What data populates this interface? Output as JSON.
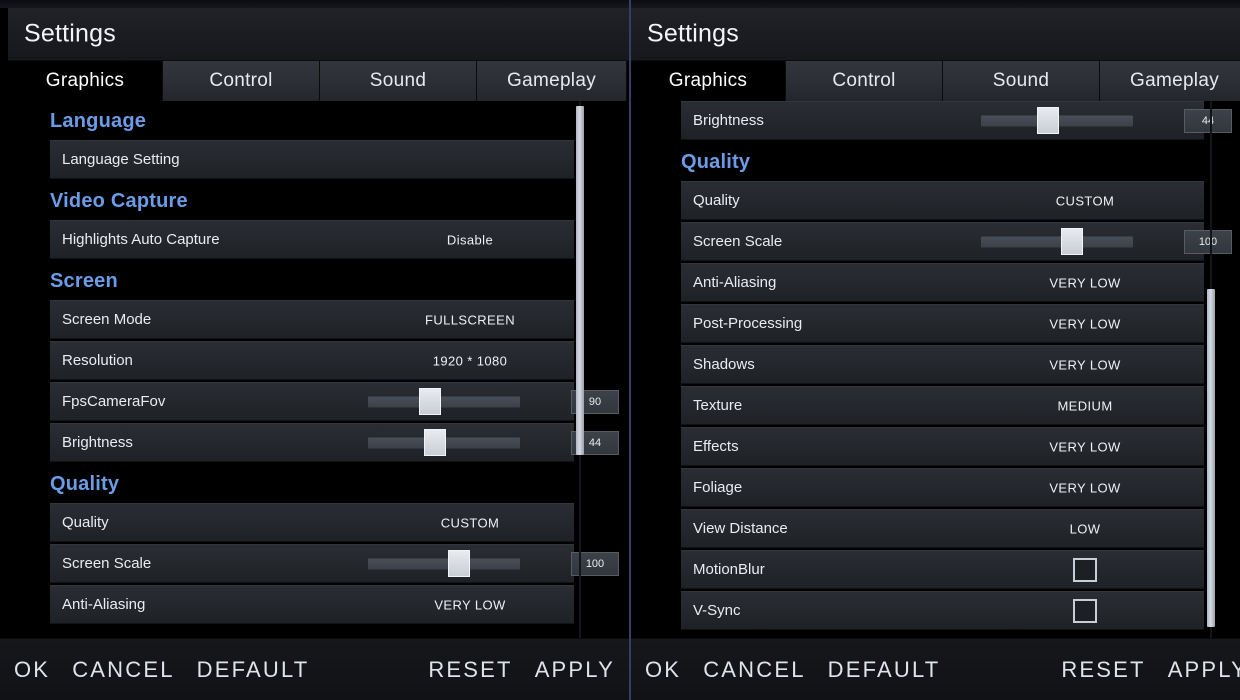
{
  "window_title": "Settings",
  "accent_section_color": "#6c9ce8",
  "divider_color": "#3a3f6e",
  "tabs": [
    {
      "label": "Graphics",
      "active": true
    },
    {
      "label": "Control",
      "active": false
    },
    {
      "label": "Sound",
      "active": false
    },
    {
      "label": "Gameplay",
      "active": false
    }
  ],
  "left_panel": {
    "title": "Settings",
    "scroll": {
      "thumb_top_pct": 1,
      "thumb_height_pct": 65
    },
    "items": [
      {
        "kind": "section",
        "label": "Language"
      },
      {
        "kind": "row",
        "label": "Language Setting",
        "value": ""
      },
      {
        "kind": "section",
        "label": "Video Capture"
      },
      {
        "kind": "row",
        "label": "Highlights Auto Capture",
        "value": "Disable"
      },
      {
        "kind": "section",
        "label": "Screen"
      },
      {
        "kind": "row",
        "label": "Screen Mode",
        "value": "FULLSCREEN"
      },
      {
        "kind": "row",
        "label": "Resolution",
        "value": "1920 * 1080"
      },
      {
        "kind": "slider",
        "label": "FpsCameraFov",
        "value": "90",
        "fill_pct": 41
      },
      {
        "kind": "slider",
        "label": "Brightness",
        "value": "44",
        "fill_pct": 44
      },
      {
        "kind": "section",
        "label": "Quality"
      },
      {
        "kind": "row",
        "label": "Quality",
        "value": "CUSTOM"
      },
      {
        "kind": "slider",
        "label": "Screen Scale",
        "value": "100",
        "fill_pct": 60
      },
      {
        "kind": "row",
        "label": "Anti-Aliasing",
        "value": "VERY LOW"
      }
    ]
  },
  "right_panel": {
    "title": "Settings",
    "scroll": {
      "thumb_top_pct": 35,
      "thumb_height_pct": 63
    },
    "items": [
      {
        "kind": "slider",
        "label": "Brightness",
        "value": "44",
        "fill_pct": 44
      },
      {
        "kind": "section",
        "label": "Quality"
      },
      {
        "kind": "row",
        "label": "Quality",
        "value": "CUSTOM"
      },
      {
        "kind": "slider",
        "label": "Screen Scale",
        "value": "100",
        "fill_pct": 60
      },
      {
        "kind": "row",
        "label": "Anti-Aliasing",
        "value": "VERY LOW"
      },
      {
        "kind": "row",
        "label": "Post-Processing",
        "value": "VERY LOW"
      },
      {
        "kind": "row",
        "label": "Shadows",
        "value": "VERY LOW"
      },
      {
        "kind": "row",
        "label": "Texture",
        "value": "MEDIUM"
      },
      {
        "kind": "row",
        "label": "Effects",
        "value": "VERY LOW"
      },
      {
        "kind": "row",
        "label": "Foliage",
        "value": "VERY LOW"
      },
      {
        "kind": "row",
        "label": "View Distance",
        "value": "LOW"
      },
      {
        "kind": "checkbox",
        "label": "MotionBlur",
        "checked": false
      },
      {
        "kind": "checkbox",
        "label": "V-Sync",
        "checked": false
      }
    ]
  },
  "action_bar": {
    "left_actions": [
      {
        "label": "OK",
        "name": "ok-button"
      },
      {
        "label": "CANCEL",
        "name": "cancel-button"
      },
      {
        "label": "DEFAULT",
        "name": "default-button"
      }
    ],
    "right_actions": [
      {
        "label": "RESET",
        "name": "reset-button"
      },
      {
        "label": "APPLY",
        "name": "apply-button"
      }
    ]
  }
}
